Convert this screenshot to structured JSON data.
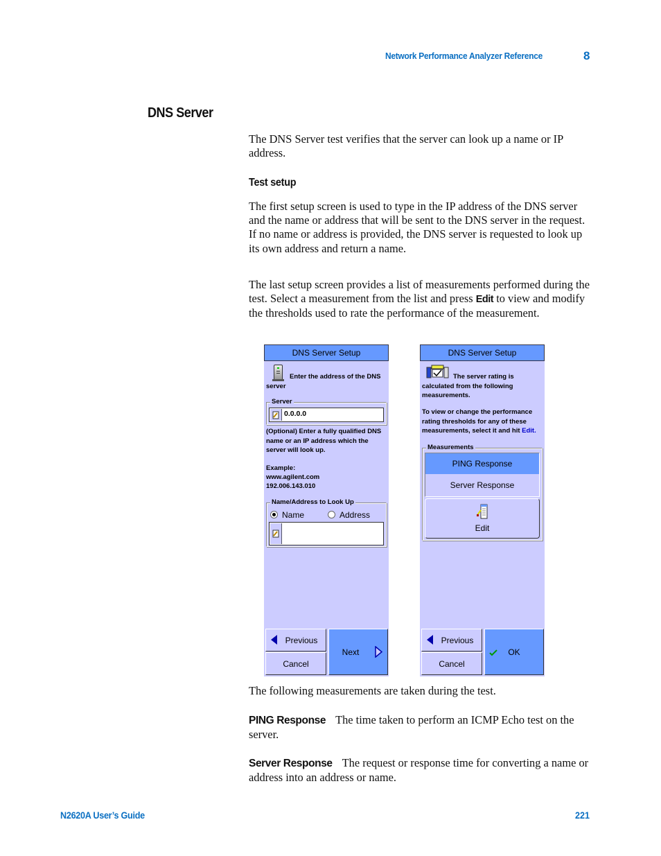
{
  "header": {
    "chapter_title": "Network Performance Analyzer Reference",
    "chapter_number": "8"
  },
  "section": {
    "title": "DNS Server",
    "intro": "The DNS Server test verifies that the server can look up a name or IP address.",
    "subsection_title": "Test setup",
    "para1": "The first setup screen is used to type in the IP address of the DNS server and the name or address that will be sent to the DNS server in the request. If no name or address is provided, the DNS server is requested to look up its own address and return a name.",
    "para2_before": "The last setup screen provides a list of measurements performed during the test. Select a measurement from the list and press ",
    "para2_bold": "Edit",
    "para2_after": " to view and modify the thresholds used to rate the performance of the measurement.",
    "following": "The following measurements are taken during the test.",
    "definitions": [
      {
        "term": "PING Response",
        "text": "The time taken to perform an ICMP Echo test on the server."
      },
      {
        "term": "Server Response",
        "text": "The request or response time for converting a name or address into an address or name."
      }
    ]
  },
  "screen1": {
    "title": "DNS Server Setup",
    "instruction": "Enter the address of the DNS server",
    "server_group_label": "Server",
    "server_value": "0.0.0.0",
    "optional_text": "(Optional) Enter a fully qualified DNS name or an IP address which the server will look up.",
    "example_label": "Example:",
    "example_lines": [
      "www.agilent.com",
      "192.006.143.010"
    ],
    "lookup_group_label": "Name/Address to Look Up",
    "radio_name": "Name",
    "radio_address": "Address",
    "selected_radio": "Name",
    "lookup_value": "",
    "previous_label": "Previous",
    "cancel_label": "Cancel",
    "next_label": "Next"
  },
  "screen2": {
    "title": "DNS Server Setup",
    "rating_text": "The server rating is calculated from the following measurements.",
    "edit_hint_before": "To view or change the performance rating thresholds for any of these measurements, select it and hit ",
    "edit_hint_link": "Edit.",
    "measurements_label": "Measurements",
    "measurements": [
      "PING Response",
      "Server Response"
    ],
    "selected_measurement": "PING Response",
    "edit_label": "Edit",
    "previous_label": "Previous",
    "cancel_label": "Cancel",
    "ok_label": "OK"
  },
  "footer": {
    "guide_title": "N2620A User’s Guide",
    "page_number": "221"
  }
}
